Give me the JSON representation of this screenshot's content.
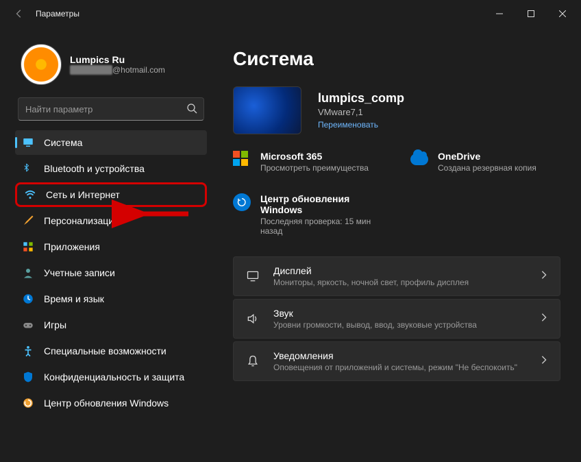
{
  "titlebar": {
    "title": "Параметры"
  },
  "user": {
    "name": "Lumpics Ru",
    "email_suffix": "@hotmail.com"
  },
  "search": {
    "placeholder": "Найти параметр"
  },
  "nav": {
    "items": [
      {
        "label": "Система",
        "icon": "monitor",
        "selected": true
      },
      {
        "label": "Bluetooth и устройства",
        "icon": "bluetooth"
      },
      {
        "label": "Сеть и Интернет",
        "icon": "wifi",
        "highlighted": true
      },
      {
        "label": "Персонализация",
        "icon": "brush"
      },
      {
        "label": "Приложения",
        "icon": "apps"
      },
      {
        "label": "Учетные записи",
        "icon": "user"
      },
      {
        "label": "Время и язык",
        "icon": "clock"
      },
      {
        "label": "Игры",
        "icon": "game"
      },
      {
        "label": "Специальные возможности",
        "icon": "access"
      },
      {
        "label": "Конфиденциальность и защита",
        "icon": "shield"
      },
      {
        "label": "Центр обновления Windows",
        "icon": "update"
      }
    ]
  },
  "main": {
    "title": "Система",
    "device": {
      "name": "lumpics_comp",
      "model": "VMware7,1",
      "rename": "Переименовать"
    },
    "promos": [
      {
        "title": "Microsoft 365",
        "sub": "Просмотреть преимущества",
        "icon": "ms"
      },
      {
        "title": "OneDrive",
        "sub": "Создана резервная копия",
        "icon": "onedrive"
      }
    ],
    "update": {
      "title": "Центр обновления Windows",
      "sub": "Последняя проверка: 15 мин назад"
    },
    "items": [
      {
        "title": "Дисплей",
        "sub": "Мониторы, яркость, ночной свет, профиль дисплея",
        "icon": "display"
      },
      {
        "title": "Звук",
        "sub": "Уровни громкости, вывод, ввод, звуковые устройства",
        "icon": "sound"
      },
      {
        "title": "Уведомления",
        "sub": "Оповещения от приложений и системы, режим \"Не беспокоить\"",
        "icon": "bell"
      }
    ]
  }
}
